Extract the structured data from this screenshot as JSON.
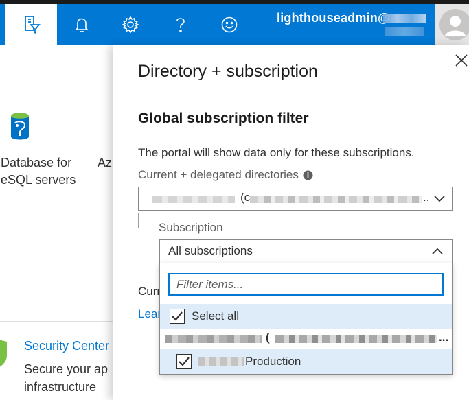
{
  "topbar": {
    "user_label": "lighthouseadmin@",
    "icons": [
      "directory-filter-icon",
      "bell-icon",
      "gear-icon",
      "help-icon",
      "smiley-icon",
      "avatar"
    ]
  },
  "background": {
    "tile1_line1": "Database for",
    "tile1_line2": "eSQL servers",
    "tile2_fragment": "Az",
    "security_title": "Security Center",
    "security_line1": "Secure your ap",
    "security_line2": "infrastructure",
    "current_fragment": "Curr",
    "learn_fragment": "Lear"
  },
  "panel": {
    "title": "Directory + subscription",
    "section_title": "Global subscription filter",
    "description": "The portal will show data only for these subscriptions.",
    "directories_label": "Current + delegated directories",
    "directory_value_paren": "(c",
    "directory_value_ellipsis": "..",
    "subscription_label": "Subscription",
    "subscription_value": "All subscriptions"
  },
  "dropdown": {
    "filter_placeholder": "Filter items...",
    "select_all_label": "Select all",
    "tenant_paren": "(",
    "tenant_ellipsis": "...",
    "production_label": "Production",
    "select_all_checked": true,
    "production_checked": true
  },
  "colors": {
    "accent": "#0078d4",
    "selected_row": "#deecf9",
    "text": "#323130"
  }
}
